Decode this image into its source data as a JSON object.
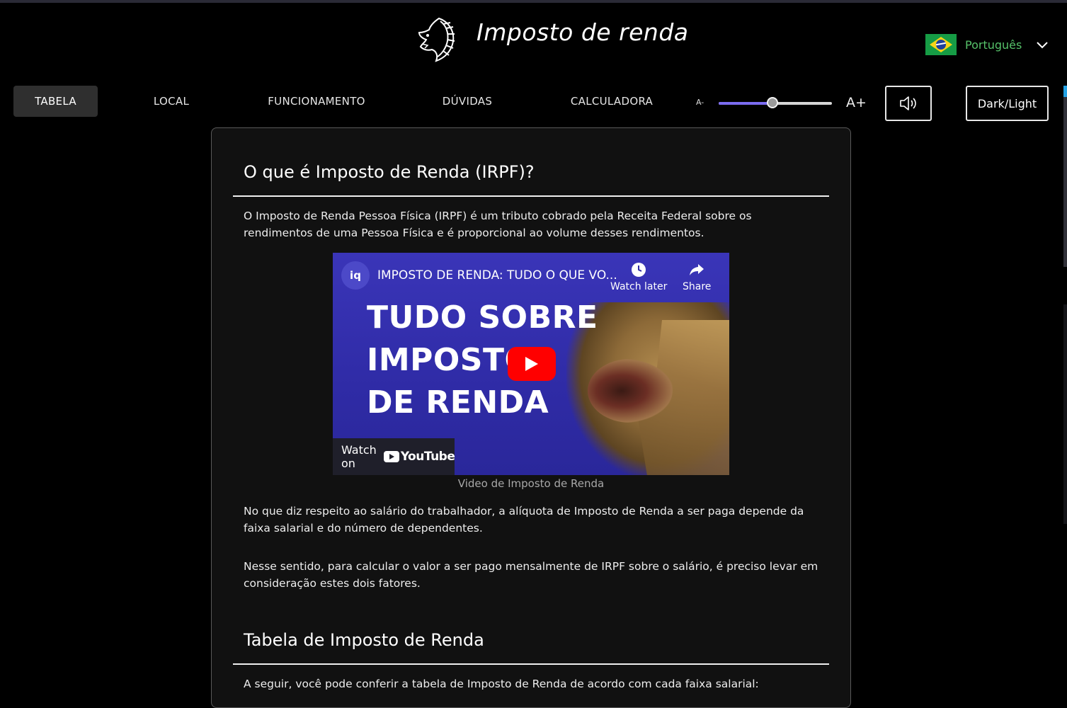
{
  "header": {
    "site_title": "Imposto de renda",
    "logo_icon": "lion-icon",
    "language": {
      "label": "Português",
      "flag": "brazil-flag-icon"
    }
  },
  "nav": {
    "items": [
      {
        "label": "TABELA",
        "active": true
      },
      {
        "label": "LOCAL",
        "active": false
      },
      {
        "label": "FUNCIONAMENTO",
        "active": false
      },
      {
        "label": "DÚVIDAS",
        "active": false
      },
      {
        "label": "CALCULADORA",
        "active": false
      }
    ],
    "font_decrease_label": "A-",
    "font_increase_label": "A+",
    "font_slider_value": 0.48,
    "audio_icon": "speaker-icon",
    "theme_toggle_label": "Dark/Light",
    "accent_color": "#7b6cf0"
  },
  "content": {
    "section1_title": "O que é Imposto de Renda (IRPF)?",
    "section1_intro": "O Imposto de Renda Pessoa Física (IRPF) é um tributo cobrado pela Receita Federal sobre os rendimentos de uma Pessoa Física e é proporcional ao volume desses rendimentos.",
    "video": {
      "channel_initials": "iq",
      "title": "IMPOSTO DE RENDA: TUDO O QUE VO...",
      "watch_later_label": "Watch later",
      "share_label": "Share",
      "thumbnail_line1": "TUDO SOBRE",
      "thumbnail_line2": "IMPOSTO",
      "thumbnail_line3": "DE RENDA",
      "watch_on_label": "Watch on",
      "youtube_label": "YouTube",
      "caption": "Video de Imposto de Renda"
    },
    "para2": "No que diz respeito ao salário do trabalhador, a alíquota de Imposto de Renda a ser paga depende da faixa salarial e do número de dependentes.",
    "para3": "Nesse sentido, para calcular o valor a ser pago mensalmente de IRPF sobre o salário, é preciso levar em consideração estes dois fatores.",
    "section2_title": "Tabela de Imposto de Renda",
    "section2_intro": "A seguir, você pode conferir a tabela de Imposto de Renda de acordo com cada faixa salarial:"
  }
}
